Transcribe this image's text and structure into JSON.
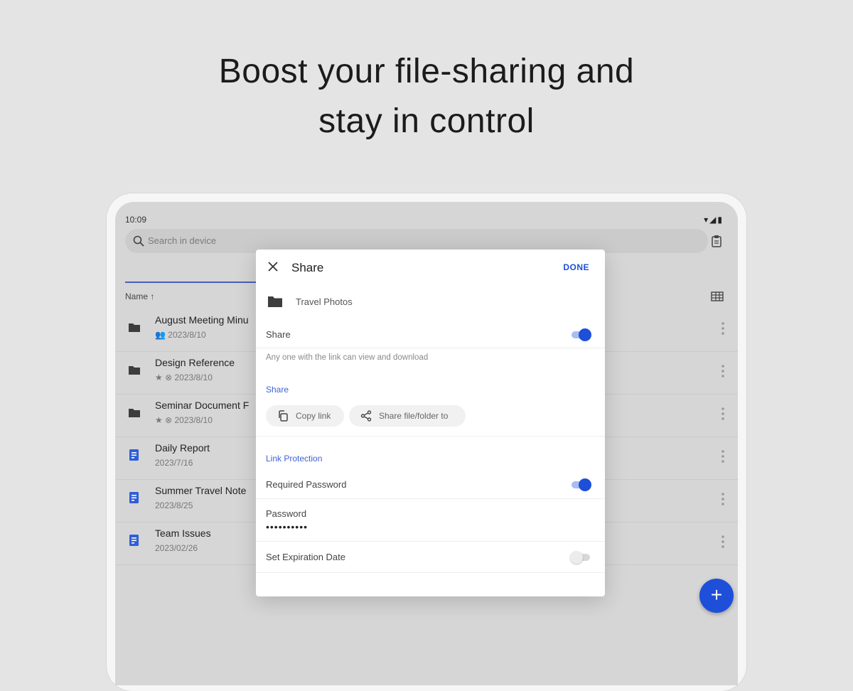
{
  "headline": {
    "line1": "Boost your file-sharing and",
    "line2": "stay in control"
  },
  "status_bar": {
    "time": "10:09",
    "icons": "▾◢▮"
  },
  "search": {
    "placeholder": "Search in device"
  },
  "list": {
    "sort_header": "Name ↑",
    "files": [
      {
        "name": "August Meeting Minu",
        "meta": "2023/8/10",
        "meta_prefix": "👥",
        "type": "folder"
      },
      {
        "name": "Design Reference",
        "meta": "2023/8/10",
        "meta_prefix": "★ ⊗",
        "type": "folder"
      },
      {
        "name": "Seminar Document F",
        "meta": "2023/8/10",
        "meta_prefix": "★ ⊗",
        "type": "folder"
      },
      {
        "name": "Daily Report",
        "meta": "2023/7/16",
        "meta_prefix": "",
        "type": "doc"
      },
      {
        "name": "Summer Travel Note",
        "meta": "2023/8/25",
        "meta_prefix": "",
        "type": "doc"
      },
      {
        "name": "Team Issues",
        "meta": "2023/02/26",
        "meta_prefix": "",
        "type": "doc"
      }
    ]
  },
  "fab": {
    "label": "+"
  },
  "dialog": {
    "title": "Share",
    "done": "DONE",
    "folder_name": "Travel Photos",
    "share_toggle_label": "Share",
    "share_toggle_on": true,
    "hint": "Any one with the link can view and download",
    "share_section": "Share",
    "copy_link": "Copy link",
    "share_to": "Share file/folder to",
    "protection_section": "Link Protection",
    "required_password_label": "Required Password",
    "required_password_on": true,
    "password_label": "Password",
    "password_value": "••••••••••",
    "expiration_label": "Set Expiration Date",
    "expiration_on": false
  },
  "colors": {
    "accent": "#1d4fd8",
    "section_blue": "#3f62d8",
    "background": "#e4e4e4"
  }
}
